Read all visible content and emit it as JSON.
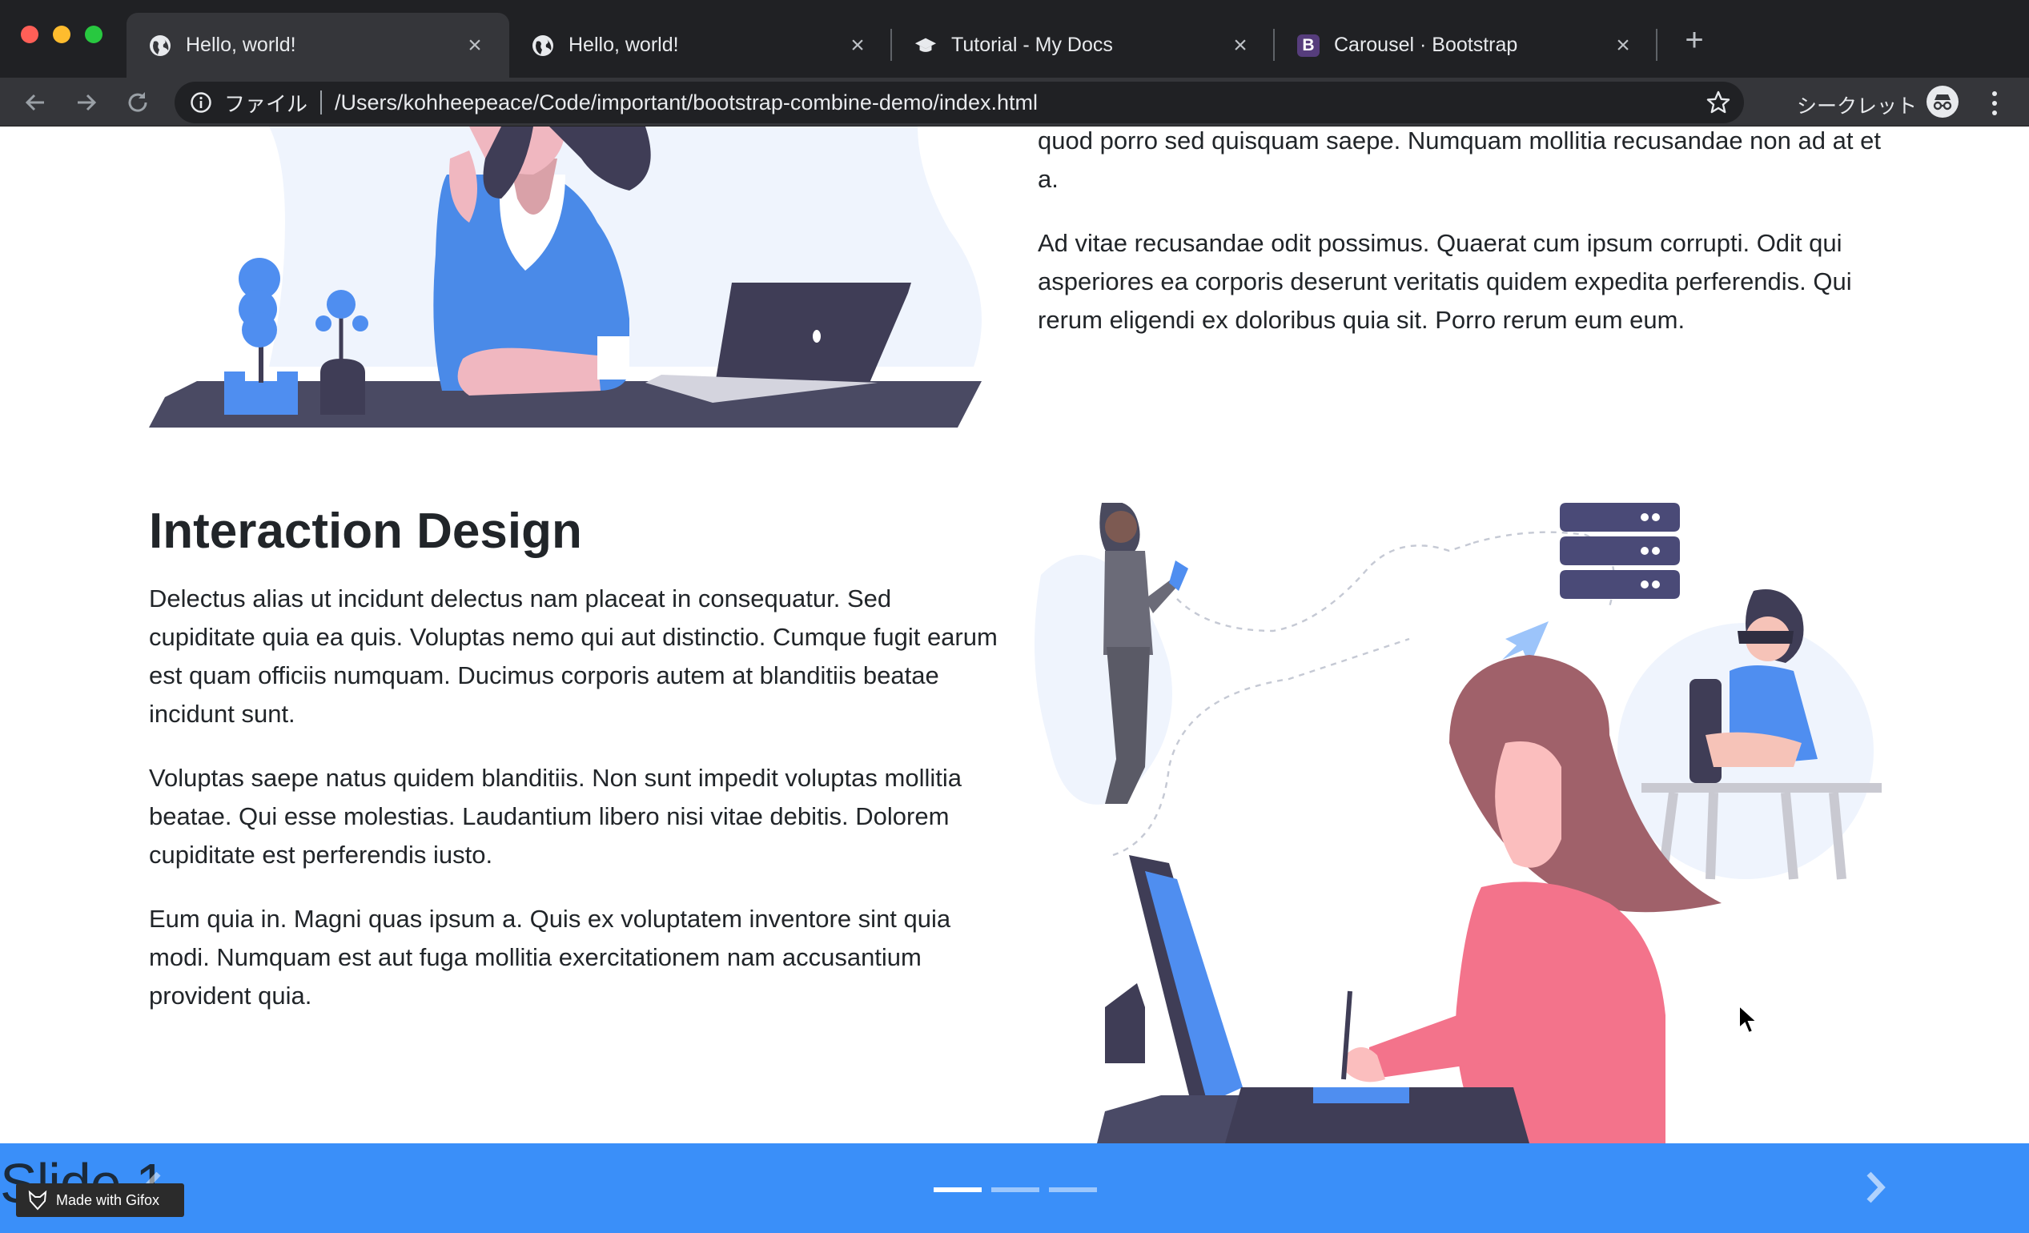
{
  "browser": {
    "tabs": [
      {
        "title": "Hello, world!",
        "icon": "globe-icon",
        "active": true
      },
      {
        "title": "Hello, world!",
        "icon": "globe-icon",
        "active": false
      },
      {
        "title": "Tutorial - My Docs",
        "icon": "graduation-cap-icon",
        "active": false
      },
      {
        "title": "Carousel · Bootstrap",
        "icon": "bootstrap-icon",
        "active": false
      }
    ],
    "scheme_label": "ファイル",
    "url": "/Users/kohheepeace/Code/important/bootstrap-combine-demo/index.html",
    "incognito_label": "シークレット",
    "bootstrap_glyph": "B"
  },
  "content": {
    "top_right_paragraphs": [
      "quod porro sed quisquam saepe. Numquam mollitia recusandae non ad at et a.",
      "Ad vitae recusandae odit possimus. Quaerat cum ipsum corrupti. Odit qui asperiores ea corporis deserunt veritatis quidem expedita perferendis. Qui rerum eligendi ex doloribus quia sit. Porro rerum eum eum."
    ],
    "section_title": "Interaction Design",
    "section_paragraphs": [
      "Delectus alias ut incidunt delectus nam placeat in consequatur. Sed cupiditate quia ea quis. Voluptas nemo qui aut distinctio. Cumque fugit earum est quam officiis numquam. Ducimus corporis autem at blanditiis beatae incidunt sunt.",
      "Voluptas saepe natus quidem blanditiis. Non sunt impedit voluptas mollitia beatae. Qui esse molestias. Laudantium libero nisi vitae debitis. Dolorem cupiditate est perferendis iusto.",
      "Eum quia in. Magni quas ipsum a. Quis ex voluptatem inventore sint quia modi. Numquam est aut fuga mollitia exercitationem nam accusantium provident quia."
    ]
  },
  "carousel": {
    "slide_label": "Slide 1",
    "indicator_count": 3,
    "active_index": 0,
    "watermark": "Made with Gifox"
  },
  "colors": {
    "carousel_bg": "#3a8ff9",
    "chrome_dark": "#202124",
    "chrome_tab": "#35363a",
    "text": "#212529"
  }
}
